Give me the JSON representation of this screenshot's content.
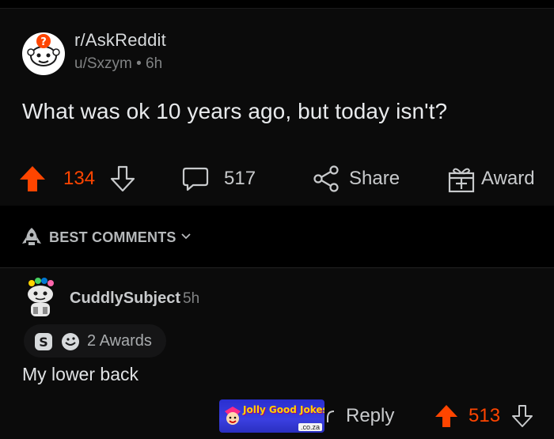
{
  "post": {
    "subreddit": "r/AskReddit",
    "meta": "u/Sxzym • 6h",
    "title": "What was ok 10 years ago, but today isn't?",
    "upvotes": "134",
    "comments": "517",
    "share_label": "Share",
    "award_label": "Award"
  },
  "sort": {
    "label": "BEST COMMENTS"
  },
  "comment": {
    "username": "CuddlySubject",
    "time": "5h",
    "awards": "2 Awards",
    "body": "My lower back",
    "reply_label": "Reply",
    "upvotes": "513"
  },
  "watermark": {
    "title": "Jolly Good Jokes",
    "domain": ".co.za"
  },
  "colors": {
    "upvote": "#ff4500",
    "background": "#0b0b0b",
    "text": "#d7dadc",
    "muted": "#818384"
  },
  "icons": [
    "subreddit-avatar-icon",
    "upvote-icon",
    "downvote-icon",
    "comment-icon",
    "share-icon",
    "award-icon",
    "rocket-icon",
    "chevron-down-icon",
    "reply-icon"
  ]
}
